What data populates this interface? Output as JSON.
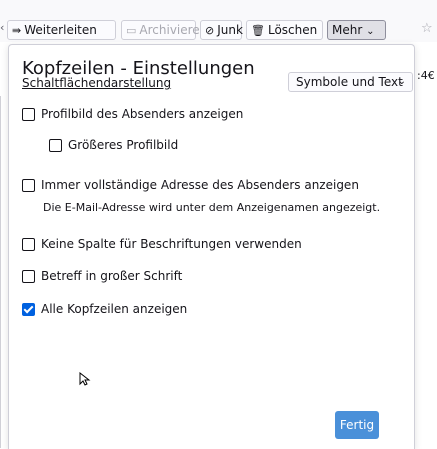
{
  "toolbar": {
    "forward_label": "Weiterleiten",
    "archive_label": "Archivieren",
    "junk_label": "Junk",
    "delete_label": "Löschen",
    "more_label": "Mehr"
  },
  "background_text": ":4€",
  "dialog": {
    "title": "Kopfzeilen - Einstellungen",
    "button_display_label": "Schaltflächendarstellung",
    "button_display_value": "Symbole und Text",
    "options": [
      {
        "label": "Profilbild des Absenders anzeigen",
        "checked": false
      },
      {
        "label": "Größeres Profilbild",
        "checked": false
      },
      {
        "label": "Immer vollständige Adresse des Absenders anzeigen",
        "checked": false
      },
      {
        "label": "Keine Spalte für Beschriftungen verwenden",
        "checked": false
      },
      {
        "label": "Betreff in großer Schrift",
        "checked": false
      },
      {
        "label": "Alle Kopfzeilen anzeigen",
        "checked": true
      }
    ],
    "full_address_description": "Die E-Mail-Adresse wird unter dem Anzeigenamen angezeigt.",
    "done_label": "Fertig"
  },
  "colors": {
    "accent": "#0061e0",
    "done_button": "#4a90d9",
    "panel_border": "#cfcfd8"
  },
  "icons": [
    "forward-icon",
    "archive-icon",
    "junk-icon",
    "trash-icon",
    "chevron-down-icon",
    "star-icon",
    "checkbox",
    "mouse-cursor"
  ]
}
